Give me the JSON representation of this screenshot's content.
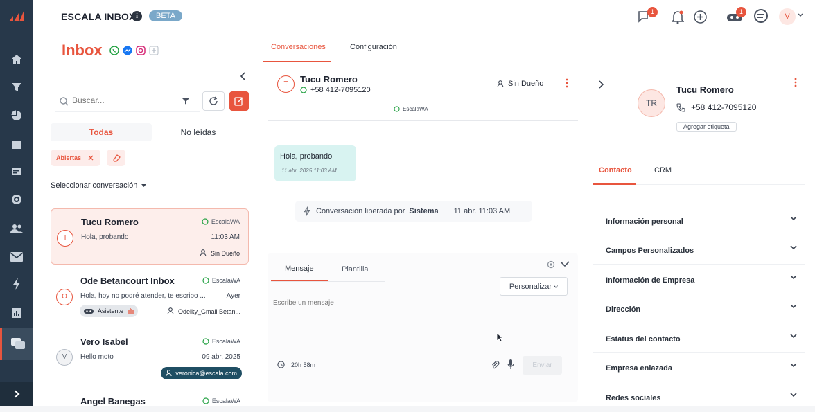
{
  "topbar": {
    "app_title": "ESCALA INBOX",
    "info_glyph": "i",
    "beta_label": "BETA",
    "chat_badge": "1",
    "agent_badge": "1",
    "avatar_initial": "V"
  },
  "inbox": {
    "title": "Inbox",
    "channels": [
      "whatsapp-icon",
      "messenger-icon",
      "instagram-icon",
      "add-channel-icon"
    ],
    "search_placeholder": "Buscar...",
    "tabs": [
      "Todas",
      "No leídas"
    ],
    "filter_chip": "Abiertas",
    "select_label": "Seleccionar conversación",
    "conversations": [
      {
        "initial": "T",
        "name": "Tucu Romero",
        "channel": "EscalaWA",
        "preview": "Hola, probando",
        "time": "11:03 AM",
        "owner": "Sin Dueño"
      },
      {
        "initial": "O",
        "name": "Ode Betancourt Inbox",
        "channel": "EscalaWA",
        "preview": "Hola, hoy no podré atender, te escribo ...",
        "time": "Ayer",
        "assistant": "Asistente",
        "owner": "Odelky_Gmail Betan..."
      },
      {
        "initial": "V",
        "name": "Vero Isabel",
        "channel": "EscalaWA",
        "preview": "Hello moto",
        "time": "09 abr. 2025",
        "owner": "veronica@escala.com"
      },
      {
        "name": "Angel Banegas",
        "channel": "EscalaWA"
      }
    ]
  },
  "conversation": {
    "tabs": [
      "Conversaciones",
      "Configuración"
    ],
    "contact_initial": "T",
    "contact_name": "Tucu Romero",
    "contact_phone": "+58 412-7095120",
    "owner_label": "Sin Dueño",
    "channel_label": "EscalaWA",
    "message_text": "Hola, probando",
    "message_time": "11 abr. 2025 11:03 AM",
    "event_prefix": "Conversación liberada por",
    "event_actor": "Sistema",
    "event_time": "11 abr. 11:03 AM",
    "composer_tabs": [
      "Mensaje",
      "Plantilla"
    ],
    "personalize_label": "Personalizar",
    "composer_placeholder": "Escribe un mensaje",
    "timer_label": "20h 58m",
    "send_label": "Enviar"
  },
  "contact_panel": {
    "initials": "TR",
    "name": "Tucu Romero",
    "phone": "+58 412-7095120",
    "add_tag_label": "Agregar etiqueta",
    "tabs": [
      "Contacto",
      "CRM"
    ],
    "sections": [
      "Información personal",
      "Campos Personalizados",
      "Información de Empresa",
      "Dirección",
      "Estatus del contacto",
      "Empresa enlazada",
      "Redes sociales"
    ]
  },
  "colors": {
    "accent": "#e8553e",
    "rail": "#27384a",
    "bubble": "#d8f3f1",
    "whatsapp": "#25a244"
  }
}
